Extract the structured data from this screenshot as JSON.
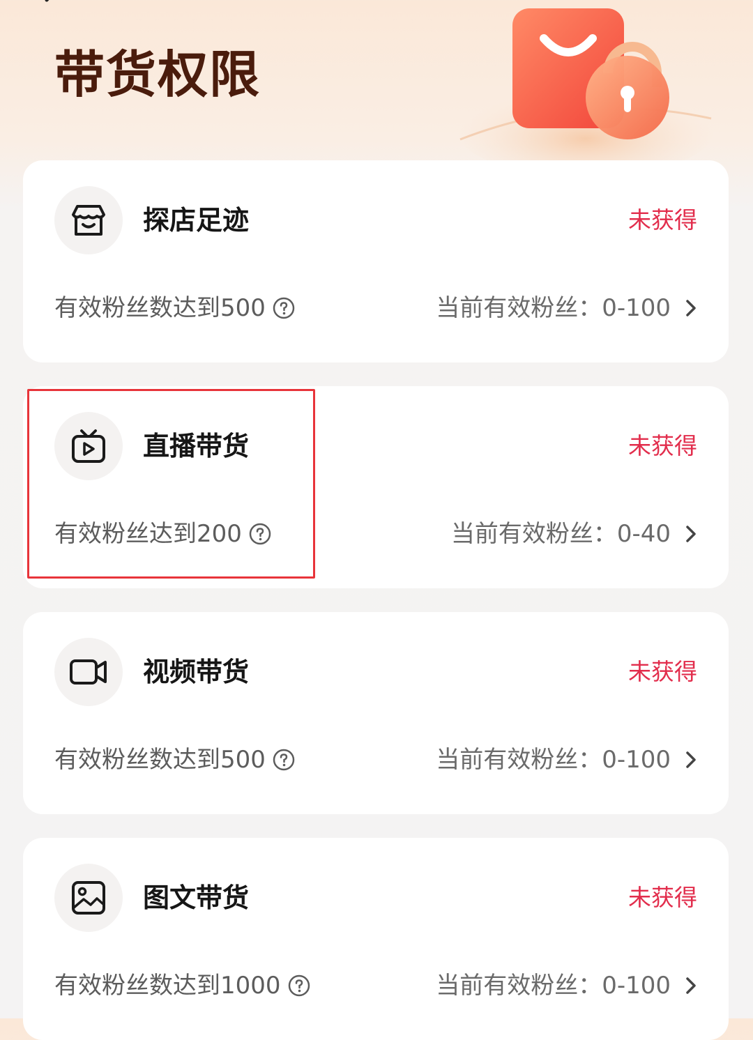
{
  "header": {
    "title": "带货权限"
  },
  "colors": {
    "accent_status": "#e22d4c",
    "title": "#4a1c0c",
    "highlight_border": "#e8343a"
  },
  "cards": [
    {
      "icon": "store-icon",
      "title": "探店足迹",
      "status": "未获得",
      "requirement": "有效粉丝数达到500",
      "current_label": "当前有效粉丝：",
      "current_value": "0-100"
    },
    {
      "icon": "live-tv-icon",
      "title": "直播带货",
      "status": "未获得",
      "requirement": "有效粉丝达到200",
      "current_label": "当前有效粉丝：",
      "current_value": "0-40"
    },
    {
      "icon": "video-camera-icon",
      "title": "视频带货",
      "status": "未获得",
      "requirement": "有效粉丝数达到500",
      "current_label": "当前有效粉丝：",
      "current_value": "0-100"
    },
    {
      "icon": "image-icon",
      "title": "图文带货",
      "status": "未获得",
      "requirement": "有效粉丝数达到1000",
      "current_label": "当前有效粉丝：",
      "current_value": "0-100"
    }
  ]
}
